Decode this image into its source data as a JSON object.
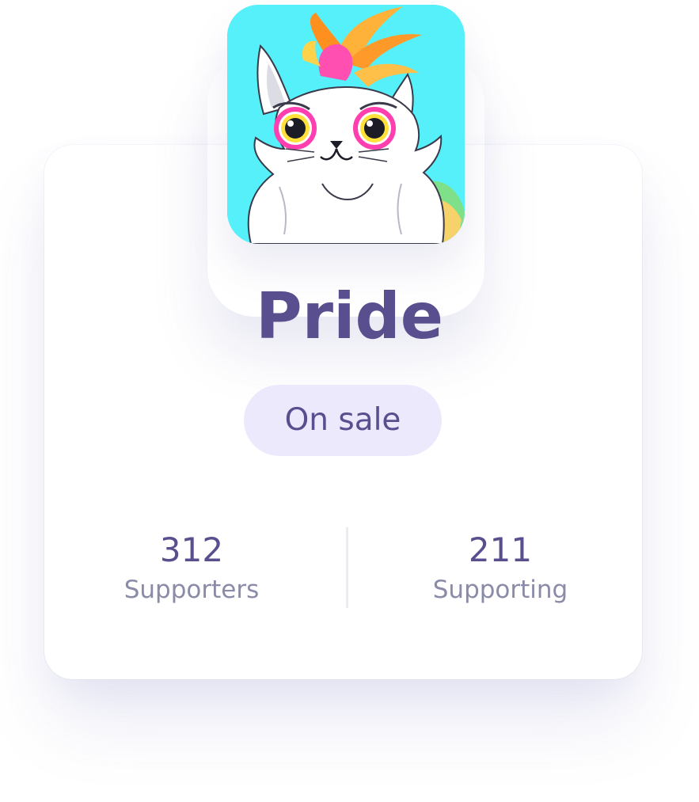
{
  "profile": {
    "name": "Pride",
    "status_badge": "On sale",
    "avatar_icon": "white-cat-with-flame-hair",
    "avatar_background": "#55f0fa"
  },
  "stats": [
    {
      "value": "312",
      "label": "Supporters"
    },
    {
      "value": "211",
      "label": "Supporting"
    }
  ],
  "colors": {
    "accent": "#5a4f8e",
    "badge_background": "#ece9fd",
    "label_gray": "#8a8ba8"
  }
}
